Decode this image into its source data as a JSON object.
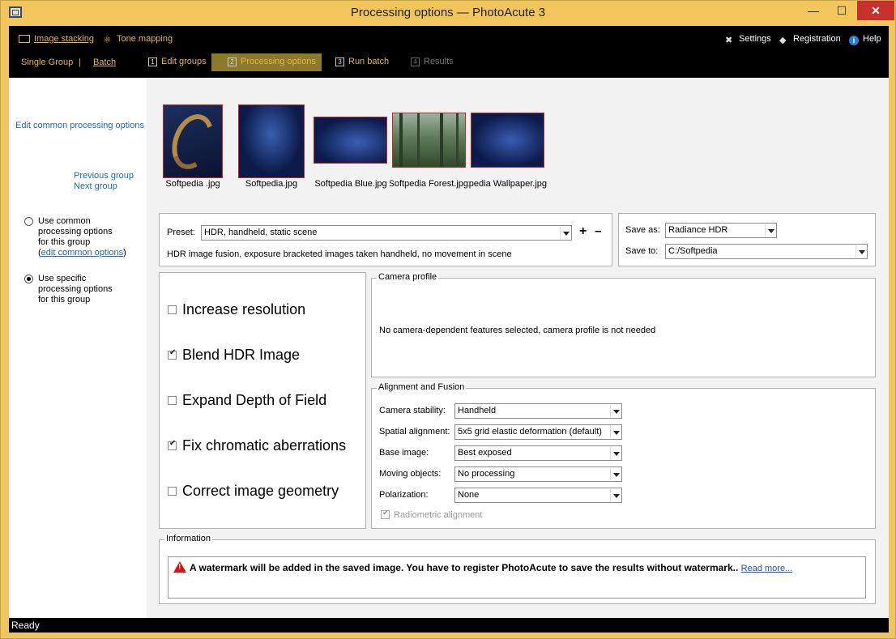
{
  "window": {
    "title": "Processing options — PhotoAcute 3",
    "minimize": "—",
    "maximize": "☐",
    "close": "✕"
  },
  "nav": {
    "modes": [
      {
        "label": "Image stacking",
        "icon": "image-stack-icon"
      },
      {
        "label": "Tone mapping",
        "icon": "tone-mapping-icon"
      }
    ],
    "right": [
      {
        "label": "Settings",
        "icon": "tools-icon"
      },
      {
        "label": "Registration",
        "icon": "key-icon"
      },
      {
        "label": "Help",
        "icon": "info-icon"
      }
    ],
    "group_modes": [
      "Single Group",
      "|",
      "Batch"
    ],
    "steps": [
      {
        "num": "1",
        "label": "Edit groups"
      },
      {
        "num": "2",
        "label": "Processing options"
      },
      {
        "num": "3",
        "label": "Run batch"
      },
      {
        "num": "4",
        "label": "Results"
      }
    ]
  },
  "sidebar": {
    "edit_common": "Edit common processing options",
    "previous_group": "Previous group",
    "next_group": "Next group",
    "use_common": [
      "Use common",
      "processing options",
      "for this group"
    ],
    "edit_common_options": "edit common options",
    "use_specific": [
      "Use specific",
      "processing options",
      "for this group"
    ]
  },
  "thumbnails": [
    {
      "label": "Softpedia .jpg"
    },
    {
      "label": "Softpedia.jpg"
    },
    {
      "label": "Softpedia Blue.jpg"
    },
    {
      "label": "Softpedia Forest.jpg"
    },
    {
      "label": "Softpedia Wallpaper.jpg"
    }
  ],
  "preset": {
    "label": "Preset:",
    "value": "HDR, handheld, static scene",
    "description": "HDR image fusion, exposure bracketed images taken handheld, no movement in scene",
    "add": "+",
    "remove": "–"
  },
  "save": {
    "save_as_label": "Save as:",
    "save_as_value": "Radiance HDR",
    "save_to_label": "Save to:",
    "save_to_value": "C:/Softpedia"
  },
  "options": [
    {
      "label": "Increase resolution",
      "checked": false
    },
    {
      "label": "Blend HDR Image",
      "checked": true
    },
    {
      "label": "Expand Depth of Field",
      "checked": false
    },
    {
      "label": "Fix chromatic aberrations",
      "checked": true
    },
    {
      "label": "Correct image geometry",
      "checked": false
    }
  ],
  "camera_profile": {
    "title": "Camera profile",
    "message": "No camera-dependent features selected, camera profile is not needed"
  },
  "alignment": {
    "title": "Alignment and Fusion",
    "rows": [
      {
        "label": "Camera stability:",
        "value": "Handheld"
      },
      {
        "label": "Spatial alignment:",
        "value": "5x5 grid elastic deformation (default)"
      },
      {
        "label": "Base image:",
        "value": "Best exposed"
      },
      {
        "label": "Moving objects:",
        "value": "No processing"
      },
      {
        "label": "Polarization:",
        "value": "None"
      }
    ],
    "radiometric": "Radiometric alignment"
  },
  "information": {
    "title": "Information",
    "message": "A watermark will be added in the saved image. You have to register PhotoAcute to save the results without watermark..",
    "link": "Read more..."
  },
  "status": "Ready"
}
